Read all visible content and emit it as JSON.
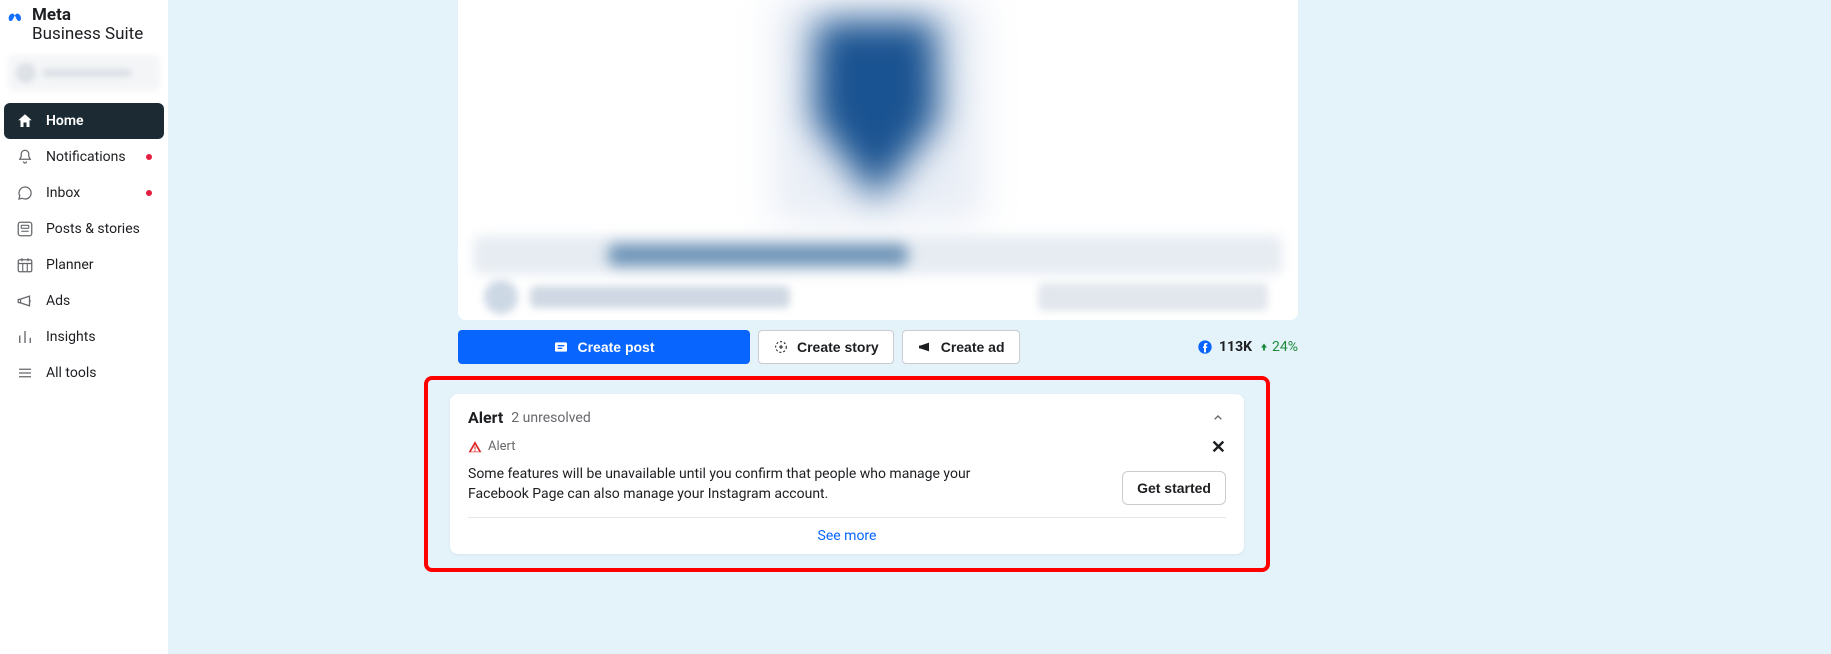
{
  "brand": {
    "line1": "Meta",
    "line2": "Business Suite"
  },
  "sidebar": {
    "items": [
      {
        "label": "Home",
        "icon": "home-icon",
        "active": true,
        "dot": false
      },
      {
        "label": "Notifications",
        "icon": "bell-icon",
        "active": false,
        "dot": true
      },
      {
        "label": "Inbox",
        "icon": "chat-icon",
        "active": false,
        "dot": true
      },
      {
        "label": "Posts & stories",
        "icon": "posts-icon",
        "active": false,
        "dot": false
      },
      {
        "label": "Planner",
        "icon": "calendar-icon",
        "active": false,
        "dot": false
      },
      {
        "label": "Ads",
        "icon": "megaphone-icon",
        "active": false,
        "dot": false
      },
      {
        "label": "Insights",
        "icon": "chart-icon",
        "active": false,
        "dot": false
      },
      {
        "label": "All tools",
        "icon": "menu-icon",
        "active": false,
        "dot": false
      }
    ]
  },
  "actions": {
    "create_post": "Create post",
    "create_story": "Create story",
    "create_ad": "Create ad"
  },
  "stats": {
    "value": "113K",
    "change": "24%",
    "direction": "up"
  },
  "alert_panel": {
    "title": "Alert",
    "subtitle": "2 unresolved",
    "badge_label": "Alert",
    "message": "Some features will be unavailable until you confirm that people who manage your Facebook Page can also manage your Instagram account.",
    "cta": "Get started",
    "see_more": "See more"
  }
}
